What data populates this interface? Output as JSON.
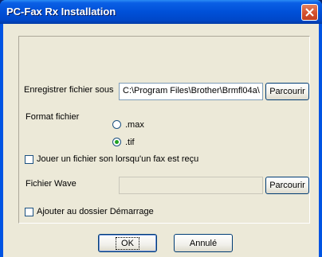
{
  "window": {
    "title": "PC-Fax Rx Installation"
  },
  "form": {
    "save_label": "Enregistrer fichier sous",
    "save_path": "C:\\Program Files\\Brother\\Brmfl04a\\",
    "browse_label": "Parcourir",
    "format_label": "Format fichier",
    "format_options": [
      ".max",
      ".tif"
    ],
    "format_selected": ".tif",
    "sound_checkbox_label": "Jouer un fichier son lorsqu'un fax est reçu",
    "sound_checked": false,
    "wave_label": "Fichier Wave",
    "wave_value": "",
    "wave_browse_label": "Parcourir",
    "startup_checkbox_label": "Ajouter au dossier Démarrage",
    "startup_checked": false
  },
  "buttons": {
    "ok": "OK",
    "cancel": "Annulé"
  },
  "colors": {
    "titlebar": "#0054e3",
    "dialog_bg": "#ece9d8",
    "close_button": "#d4502e",
    "radio_dot": "#21a121"
  }
}
